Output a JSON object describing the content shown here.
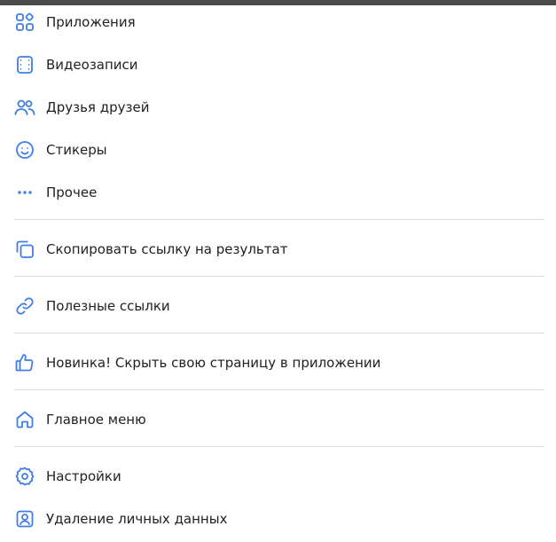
{
  "colors": {
    "accent": "#3f7ee8",
    "text": "#1f1f1f",
    "divider": "#dcdcdc",
    "topbar": "#4a4a4a"
  },
  "menu": {
    "items": [
      {
        "label": "Приложения",
        "icon": "apps-icon"
      },
      {
        "label": "Видеозаписи",
        "icon": "film-icon"
      },
      {
        "label": "Друзья друзей",
        "icon": "users-icon"
      },
      {
        "label": "Стикеры",
        "icon": "smile-icon"
      },
      {
        "label": "Прочее",
        "icon": "more-icon"
      },
      {
        "label": "Скопировать ссылку на результат",
        "icon": "copy-icon"
      },
      {
        "label": "Полезные ссылки",
        "icon": "link-icon"
      },
      {
        "label": "Новинка! Скрыть свою страницу в приложении",
        "icon": "thumbs-up-icon"
      },
      {
        "label": "Главное меню",
        "icon": "home-icon"
      },
      {
        "label": "Настройки",
        "icon": "gear-icon"
      },
      {
        "label": "Удаление личных данных",
        "icon": "user-card-icon"
      }
    ]
  }
}
